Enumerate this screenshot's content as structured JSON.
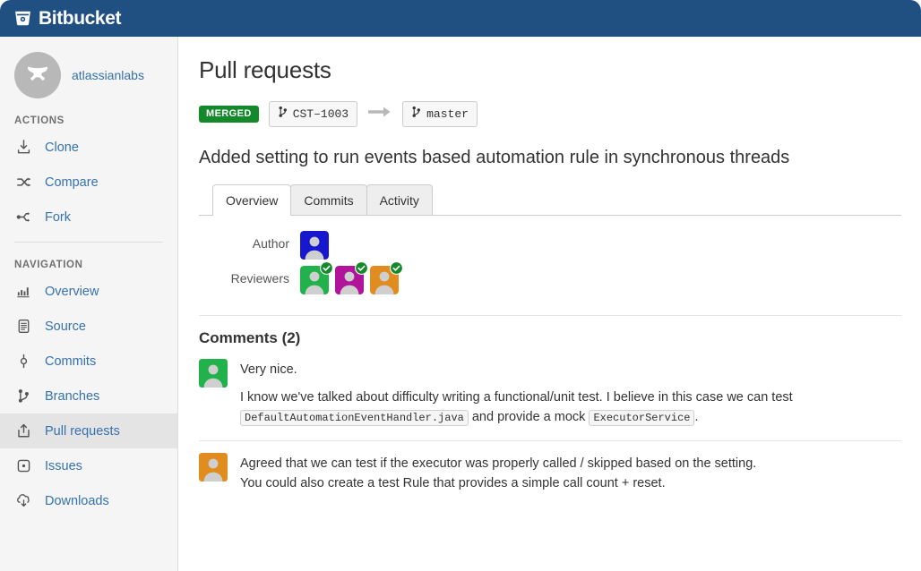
{
  "header": {
    "brand_name": "Bitbucket",
    "brand_icon": "bitbucket-bucket-logo",
    "background_color": "#205081"
  },
  "sidebar": {
    "repo_name": "atlassianlabs",
    "repo_avatar_icon": "atlassian-labs-logo",
    "actions_label": "ACTIONS",
    "navigation_label": "NAVIGATION",
    "actions": [
      {
        "label": "Clone",
        "icon": "clone-download-icon"
      },
      {
        "label": "Compare",
        "icon": "compare-arrows-icon"
      },
      {
        "label": "Fork",
        "icon": "fork-icon"
      }
    ],
    "navigation": [
      {
        "label": "Overview",
        "icon": "overview-bars-icon",
        "active": false
      },
      {
        "label": "Source",
        "icon": "source-document-icon",
        "active": false
      },
      {
        "label": "Commits",
        "icon": "commits-node-icon",
        "active": false
      },
      {
        "label": "Branches",
        "icon": "branches-icon",
        "active": false
      },
      {
        "label": "Pull requests",
        "icon": "pull-request-upload-icon",
        "active": true
      },
      {
        "label": "Issues",
        "icon": "issues-dot-square-icon",
        "active": false
      },
      {
        "label": "Downloads",
        "icon": "downloads-cloud-icon",
        "active": false
      }
    ]
  },
  "main": {
    "page_title": "Pull requests",
    "status_badge": "MERGED",
    "status_badge_color": "#14892c",
    "source_branch": "CST–1003",
    "target_branch": "master",
    "branch_icon": "branch-icon",
    "arrow_icon": "arrow-right-icon",
    "pr_title": "Added setting to run events based automation rule in synchronous threads",
    "tabs": [
      {
        "label": "Overview",
        "active": true
      },
      {
        "label": "Commits",
        "active": false
      },
      {
        "label": "Activity",
        "active": false
      }
    ],
    "meta": {
      "author_label": "Author",
      "reviewers_label": "Reviewers",
      "author": {
        "color": "#1718CE"
      },
      "reviewers": [
        {
          "color": "#22B24C",
          "approved": true
        },
        {
          "color": "#B0149B",
          "approved": true
        },
        {
          "color": "#E08C1E",
          "approved": true
        }
      ],
      "approved_icon": "approved-check-icon"
    },
    "comments": {
      "heading": "Comments (2)",
      "items": [
        {
          "avatar_color": "#22B24C",
          "paragraphs": [
            {
              "text_before": "Very nice.",
              "code1": "",
              "text_middle": "",
              "code2": "",
              "text_after": ""
            },
            {
              "text_before": "I know we've talked about difficulty writing a functional/unit test. I believe in this case we can test ",
              "code1": "DefaultAutomationEventHandler.java",
              "text_middle": " and provide a mock ",
              "code2": "ExecutorService",
              "text_after": "."
            }
          ]
        },
        {
          "avatar_color": "#E08C1E",
          "paragraphs": [
            {
              "text_before": "Agreed that we can test if the executor was properly called / skipped based on the setting.",
              "code1": "",
              "text_middle": "",
              "code2": "",
              "text_after": ""
            },
            {
              "text_before": "You could also create a test Rule that provides a simple call count + reset.",
              "code1": "",
              "text_middle": "",
              "code2": "",
              "text_after": ""
            }
          ]
        }
      ]
    }
  }
}
